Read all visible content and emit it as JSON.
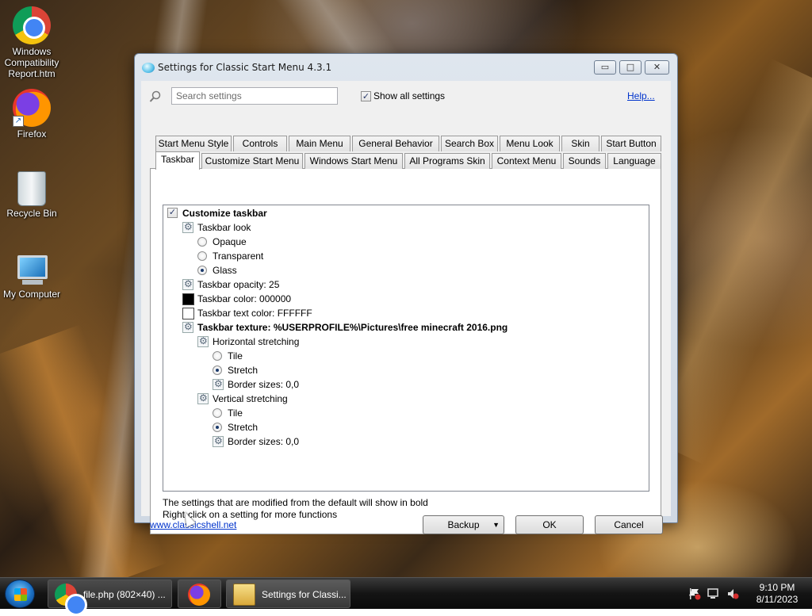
{
  "desktop": {
    "icons": [
      {
        "label": "Windows Compatibility Report.htm",
        "icon": "chrome-icon"
      },
      {
        "label": "Firefox",
        "icon": "firefox-icon"
      },
      {
        "label": "Recycle Bin",
        "icon": "recycle-bin-icon"
      },
      {
        "label": "My Computer",
        "icon": "computer-icon"
      }
    ]
  },
  "window": {
    "title": "Settings for Classic Start Menu 4.3.1",
    "controls": {
      "minimize": "▭",
      "maximize": "□",
      "close": "✕"
    },
    "search_placeholder": "Search settings",
    "show_all_label": "Show all settings",
    "show_all_checked": "✓",
    "help_link": "Help...",
    "tabs_row1": [
      "Start Menu Style",
      "Controls",
      "Main Menu",
      "General Behavior",
      "Search Box",
      "Menu Look",
      "Skin",
      "Start Button"
    ],
    "tabs_row2": [
      "Taskbar",
      "Customize Start Menu",
      "Windows Start Menu",
      "All Programs Skin",
      "Context Menu",
      "Sounds",
      "Language"
    ],
    "active_tab": "Taskbar",
    "tree": [
      {
        "type": "check",
        "label": "Customize taskbar",
        "bold": true,
        "checked": "✓"
      },
      {
        "type": "gear",
        "label": "Taskbar look"
      },
      {
        "type": "radio",
        "label": "Opaque",
        "on": false
      },
      {
        "type": "radio",
        "label": "Transparent",
        "on": false
      },
      {
        "type": "radio",
        "label": "Glass",
        "on": true
      },
      {
        "type": "gear",
        "label": "Taskbar opacity: 25"
      },
      {
        "type": "swatch",
        "label": "Taskbar color: 000000",
        "color": "#000000"
      },
      {
        "type": "swatch",
        "label": "Taskbar text color: FFFFFF",
        "color": "#FFFFFF"
      },
      {
        "type": "gear",
        "label": "Taskbar texture: %USERPROFILE%\\Pictures\\free minecraft 2016.png",
        "bold": true
      },
      {
        "type": "gear",
        "label": "Horizontal stretching"
      },
      {
        "type": "radio",
        "label": "Tile",
        "on": false
      },
      {
        "type": "radio",
        "label": "Stretch",
        "on": true
      },
      {
        "type": "gear",
        "label": "Border sizes: 0,0"
      },
      {
        "type": "gear",
        "label": "Vertical stretching"
      },
      {
        "type": "radio",
        "label": "Tile",
        "on": false
      },
      {
        "type": "radio",
        "label": "Stretch",
        "on": true
      },
      {
        "type": "gear",
        "label": "Border sizes: 0,0"
      }
    ],
    "note1": "The settings that are modified from the default will show in bold",
    "note2": "Right-click on a setting for more functions",
    "site_link": "www.classicshell.net",
    "buttons": {
      "backup": "Backup",
      "backup_arrow": "▼",
      "ok": "OK",
      "cancel": "Cancel"
    }
  },
  "taskbar": {
    "items": [
      {
        "label": "file.php (802×40) ...",
        "icon": "chrome-icon"
      },
      {
        "label": "",
        "icon": "firefox-icon"
      },
      {
        "label": "Settings for Classi...",
        "icon": "settings-folder-icon"
      }
    ],
    "tray_arrow": "▲",
    "time": "9:10 PM",
    "date": "8/11/2023"
  }
}
